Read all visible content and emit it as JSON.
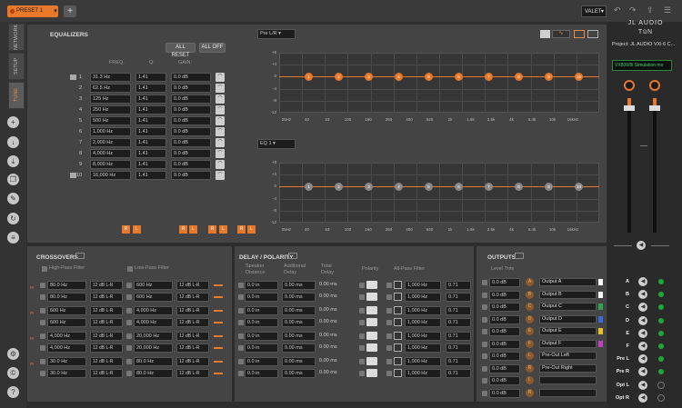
{
  "topbar": {
    "preset": "PRESET 1",
    "valet": "VALET"
  },
  "left_tabs": [
    {
      "label": "NETWORK"
    },
    {
      "label": "SETUP"
    },
    {
      "label": "TUNE"
    }
  ],
  "eq": {
    "title": "EQUALIZERS",
    "all_reset": "ALL RESET",
    "all_off": "ALL OFF",
    "col_freq": "FREQ.",
    "col_q": "Q:",
    "col_gain": "GAIN:",
    "source": "Pre L/R",
    "eq_sel": "EQ 1",
    "bands": [
      {
        "n": "1",
        "freq": "31.3 Hz",
        "q": "1.41",
        "gain": "0.0 dB"
      },
      {
        "n": "2",
        "freq": "62.5 Hz",
        "q": "1.41",
        "gain": "0.0 dB"
      },
      {
        "n": "3",
        "freq": "125 Hz",
        "q": "1.41",
        "gain": "0.0 dB"
      },
      {
        "n": "4",
        "freq": "250 Hz",
        "q": "1.41",
        "gain": "0.0 dB"
      },
      {
        "n": "5",
        "freq": "500 Hz",
        "q": "1.41",
        "gain": "0.0 dB"
      },
      {
        "n": "6",
        "freq": "1,000 Hz",
        "q": "1.41",
        "gain": "0.0 dB"
      },
      {
        "n": "7",
        "freq": "2,000 Hz",
        "q": "1.41",
        "gain": "0.0 dB"
      },
      {
        "n": "8",
        "freq": "4,000 Hz",
        "q": "1.41",
        "gain": "0.0 dB"
      },
      {
        "n": "9",
        "freq": "8,000 Hz",
        "q": "1.41",
        "gain": "0.0 dB"
      },
      {
        "n": "10",
        "freq": "16,000 Hz",
        "q": "1.41",
        "gain": "0.0 dB"
      }
    ],
    "y_ticks": [
      "+8",
      "+4",
      "0",
      "-4",
      "-8",
      "-12"
    ],
    "x_ticks": [
      "25Hz",
      "40",
      "63",
      "100",
      "160",
      "250",
      "400",
      "640",
      "1k",
      "1.6k",
      "2.5k",
      "4k",
      "6.4k",
      "10k",
      "16kHz"
    ],
    "node_labels": [
      "1",
      "2",
      "3",
      "4",
      "5",
      "6",
      "7",
      "8",
      "9",
      "10"
    ],
    "bottom_buttons": [
      "R",
      "L",
      "R",
      "L",
      "R",
      "L",
      "R",
      "L"
    ]
  },
  "crossovers": {
    "title": "CROSSOVERS",
    "hpf": "High-Pass Filter",
    "lpf": "Low-Pass Filter",
    "rows": [
      {
        "hp": "80.0 Hz",
        "hs": "12 dB L-R",
        "lp": "600 Hz",
        "ls": "12 dB L-R"
      },
      {
        "hp": "80.0 Hz",
        "hs": "12 dB L-R",
        "lp": "600 Hz",
        "ls": "12 dB L-R"
      },
      {
        "hp": "600 Hz",
        "hs": "12 dB L-R",
        "lp": "4,000 Hz",
        "ls": "12 dB L-R"
      },
      {
        "hp": "600 Hz",
        "hs": "12 dB L-R",
        "lp": "4,000 Hz",
        "ls": "12 dB L-R"
      },
      {
        "hp": "4,000 Hz",
        "hs": "12 dB L-R",
        "lp": "20,000 Hz",
        "ls": "12 dB L-R"
      },
      {
        "hp": "4,000 Hz",
        "hs": "12 dB L-R",
        "lp": "20,000 Hz",
        "ls": "12 dB L-R"
      },
      {
        "hp": "30.0 Hz",
        "hs": "12 dB L-R",
        "lp": "80.0 Hz",
        "ls": "12 dB L-R"
      },
      {
        "hp": "30.0 Hz",
        "hs": "12 dB L-R",
        "lp": "80.0 Hz",
        "ls": "12 dB L-R"
      }
    ]
  },
  "delay": {
    "title": "DELAY / POLARITY",
    "speaker": "Speaker\nDistance",
    "additional": "Additional\nDelay",
    "total": "Total\nDelay",
    "polarity": "Polarity",
    "allpass": "All-Pass Filter",
    "rows": [
      {
        "dist": "0.0 in",
        "add": "0.00 ms",
        "total": "0.00 ms",
        "ap": "1,000 Hz",
        "q": "0.71"
      },
      {
        "dist": "0.0 in",
        "add": "0.00 ms",
        "total": "0.00 ms",
        "ap": "1,000 Hz",
        "q": "0.71"
      },
      {
        "dist": "0.0 in",
        "add": "0.00 ms",
        "total": "0.00 ms",
        "ap": "1,000 Hz",
        "q": "0.71"
      },
      {
        "dist": "0.0 in",
        "add": "0.00 ms",
        "total": "0.00 ms",
        "ap": "1,000 Hz",
        "q": "0.71"
      },
      {
        "dist": "0.0 in",
        "add": "0.00 ms",
        "total": "0.00 ms",
        "ap": "1,000 Hz",
        "q": "0.71"
      },
      {
        "dist": "0.0 in",
        "add": "0.00 ms",
        "total": "0.00 ms",
        "ap": "1,000 Hz",
        "q": "0.71"
      },
      {
        "dist": "0.0 in",
        "add": "0.00 ms",
        "total": "0.00 ms",
        "ap": "1,000 Hz",
        "q": "0.71"
      },
      {
        "dist": "0.0 in",
        "add": "0.00 ms",
        "total": "0.00 ms",
        "ap": "1,000 Hz",
        "q": "0.71"
      }
    ]
  },
  "outputs": {
    "title": "OUTPUTS",
    "trim": "Level Trim",
    "rows": [
      {
        "lvl": "0.0 dB",
        "ch": "A",
        "name": "Output A"
      },
      {
        "lvl": "0.0 dB",
        "ch": "B",
        "name": "Output B"
      },
      {
        "lvl": "0.0 dB",
        "ch": "C",
        "name": "Output C"
      },
      {
        "lvl": "0.0 dB",
        "ch": "D",
        "name": "Output D"
      },
      {
        "lvl": "0.0 dB",
        "ch": "E",
        "name": "Output E"
      },
      {
        "lvl": "0.0 dB",
        "ch": "F",
        "name": "Output F"
      },
      {
        "lvl": "0.0 dB",
        "ch": "L",
        "name": "Pre-Out Left"
      },
      {
        "lvl": "0.0 dB",
        "ch": "R",
        "name": "Pre-Out Right"
      },
      {
        "lvl": "0.0 dB",
        "ch": "L",
        "name": ""
      },
      {
        "lvl": "0.0 dB",
        "ch": "R",
        "name": ""
      }
    ]
  },
  "right": {
    "brand1": "JL AUDIO",
    "brand2": "TüN",
    "project": "Project: JL AUDIO VXi 6 C...",
    "sim": "VX800/8i Simulation mo",
    "channels": [
      "A",
      "B",
      "C",
      "D",
      "E",
      "F",
      "Pre L",
      "Pre R",
      "Opt L",
      "Opt R"
    ]
  },
  "colors": {
    "accent": "#e8782a",
    "green": "#1ea83a"
  }
}
